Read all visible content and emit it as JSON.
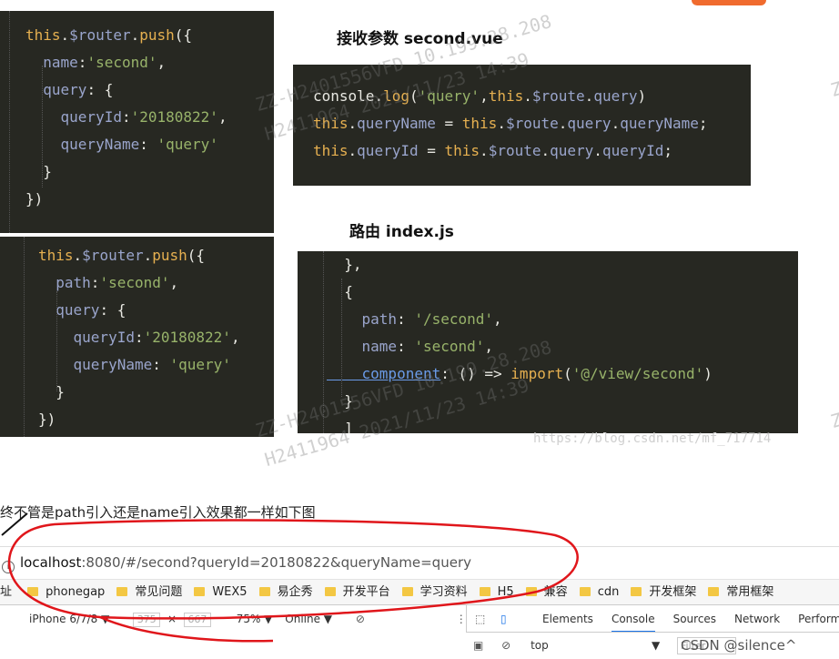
{
  "headings": {
    "second_vue": "接收参数  second.vue",
    "index_js": "路由  index.js"
  },
  "code_block_1": [
    [
      [
        "kw",
        "this"
      ],
      [
        "pl",
        "."
      ],
      [
        "prop",
        "$router"
      ],
      [
        "pl",
        "."
      ],
      [
        "fn",
        "push"
      ],
      [
        "pl",
        "({"
      ]
    ],
    [
      [
        "prop",
        "  name"
      ],
      [
        "pl",
        ":"
      ],
      [
        "str",
        "'second'"
      ],
      [
        "pl",
        ","
      ]
    ],
    [
      [
        "prop",
        "  query"
      ],
      [
        "pl",
        ": {"
      ]
    ],
    [
      [
        "prop",
        "    queryId"
      ],
      [
        "pl",
        ":"
      ],
      [
        "str",
        "'20180822'"
      ],
      [
        "pl",
        ","
      ]
    ],
    [
      [
        "prop",
        "    queryName"
      ],
      [
        "pl",
        ": "
      ],
      [
        "str",
        "'query'"
      ]
    ],
    [
      [
        "pl",
        "  }"
      ]
    ],
    [
      [
        "pl",
        "})"
      ]
    ]
  ],
  "code_block_2": [
    [
      [
        "kw",
        "this"
      ],
      [
        "pl",
        "."
      ],
      [
        "prop",
        "$router"
      ],
      [
        "pl",
        "."
      ],
      [
        "fn",
        "push"
      ],
      [
        "pl",
        "({"
      ]
    ],
    [
      [
        "prop",
        "  path"
      ],
      [
        "pl",
        ":"
      ],
      [
        "str",
        "'second'"
      ],
      [
        "pl",
        ","
      ]
    ],
    [
      [
        "prop",
        "  query"
      ],
      [
        "pl",
        ": {"
      ]
    ],
    [
      [
        "prop",
        "    queryId"
      ],
      [
        "pl",
        ":"
      ],
      [
        "str",
        "'20180822'"
      ],
      [
        "pl",
        ","
      ]
    ],
    [
      [
        "prop",
        "    queryName"
      ],
      [
        "pl",
        ": "
      ],
      [
        "str",
        "'query'"
      ]
    ],
    [
      [
        "pl",
        "  }"
      ]
    ],
    [
      [
        "pl",
        "})"
      ]
    ]
  ],
  "code_block_3": [
    [
      [
        "pl",
        "console"
      ],
      [
        "pl",
        "."
      ],
      [
        "fn",
        "log"
      ],
      [
        "pl",
        "("
      ],
      [
        "str",
        "'query'"
      ],
      [
        "pl",
        ","
      ],
      [
        "kw",
        "this"
      ],
      [
        "pl",
        "."
      ],
      [
        "prop",
        "$route"
      ],
      [
        "pl",
        "."
      ],
      [
        "prop",
        "query"
      ],
      [
        "pl",
        ")"
      ]
    ],
    [
      [
        "kw",
        "this"
      ],
      [
        "pl",
        "."
      ],
      [
        "prop",
        "queryName"
      ],
      [
        "pl",
        " = "
      ],
      [
        "kw",
        "this"
      ],
      [
        "pl",
        "."
      ],
      [
        "prop",
        "$route"
      ],
      [
        "pl",
        "."
      ],
      [
        "prop",
        "query"
      ],
      [
        "pl",
        "."
      ],
      [
        "prop",
        "queryName"
      ],
      [
        "pl",
        ";"
      ]
    ],
    [
      [
        "kw",
        "this"
      ],
      [
        "pl",
        "."
      ],
      [
        "prop",
        "queryId"
      ],
      [
        "pl",
        " = "
      ],
      [
        "kw",
        "this"
      ],
      [
        "pl",
        "."
      ],
      [
        "prop",
        "$route"
      ],
      [
        "pl",
        "."
      ],
      [
        "prop",
        "query"
      ],
      [
        "pl",
        "."
      ],
      [
        "prop",
        "queryId"
      ],
      [
        "pl",
        ";"
      ]
    ]
  ],
  "code_block_4": [
    [
      [
        "pl",
        "  },"
      ]
    ],
    [
      [
        "pl",
        "  {"
      ]
    ],
    [
      [
        "prop",
        "    path"
      ],
      [
        "pl",
        ": "
      ],
      [
        "str",
        "'/second'"
      ],
      [
        "pl",
        ","
      ]
    ],
    [
      [
        "prop",
        "    name"
      ],
      [
        "pl",
        ": "
      ],
      [
        "str",
        "'second'"
      ],
      [
        "pl",
        ","
      ]
    ],
    [
      [
        "lk",
        "    component"
      ],
      [
        "pl",
        ": () => "
      ],
      [
        "kw",
        "import"
      ],
      [
        "pl",
        "("
      ],
      [
        "str",
        "'@/view/second'"
      ],
      [
        "pl",
        ")"
      ]
    ],
    [
      [
        "pl",
        "  }"
      ]
    ],
    [
      [
        "pl",
        "  ]"
      ]
    ]
  ],
  "caption": "终不管是path引入还是name引入效果都一样如下图",
  "watermarks": {
    "line1": "ZZ-H2401556VFD  10.199.28.208",
    "line2": "H2411964 2021/11/23 14:39",
    "blog": "https://blog.csdn.net/mf_717714",
    "z": "Z"
  },
  "browser": {
    "url_host": "localhost",
    "url_rest": ":8080/#/second?queryId=20180822&queryName=query",
    "bookmarks_prefix": "址",
    "bookmarks": [
      "phonegap",
      "常见问题",
      "WEX5",
      "易企秀",
      "开发平台",
      "学习资料",
      "H5",
      "兼容",
      "cdn",
      "开发框架",
      "常用框架"
    ]
  },
  "devtools": {
    "device": "iPhone 6/7/8 ▼",
    "width": "375",
    "times": "×",
    "height": "667",
    "zoom": "75% ▼",
    "network": "Online ▼",
    "tabs": [
      "Elements",
      "Console",
      "Sources",
      "Network",
      "Performan"
    ],
    "active_tab": "Console",
    "context": "top",
    "filter_placeholder": "Filter",
    "csdn": "CSDN @silence^"
  }
}
